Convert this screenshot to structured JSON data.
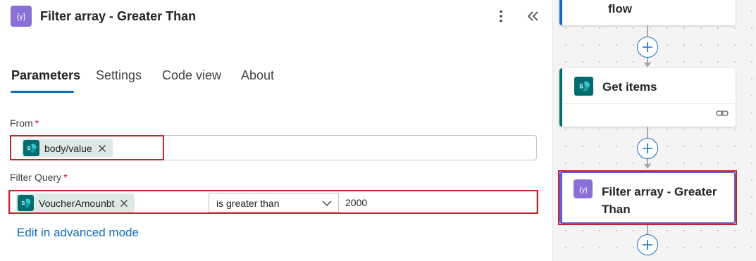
{
  "panel": {
    "title": "Filter array - Greater Than",
    "icon": "filter-array-icon",
    "more_icon": "more-vertical-icon",
    "collapse_icon": "double-chevron-left-icon",
    "tabs": [
      {
        "label": "Parameters",
        "active": true
      },
      {
        "label": "Settings",
        "active": false
      },
      {
        "label": "Code view",
        "active": false
      },
      {
        "label": "About",
        "active": false
      }
    ]
  },
  "from_field": {
    "label": "From",
    "required_mark": "*",
    "token": {
      "label": "body/value",
      "icon": "sharepoint-icon"
    }
  },
  "filter_query": {
    "label": "Filter Query",
    "required_mark": "*",
    "token": {
      "label": "VoucherAmounbt",
      "icon": "sharepoint-icon"
    },
    "operator": "is greater than",
    "value": "2000"
  },
  "advanced_mode_link": "Edit in advanced mode",
  "canvas": {
    "top_card_title": "flow",
    "get_items_card": {
      "title": "Get items",
      "icon": "sharepoint-icon",
      "link_icon": "link-icon"
    },
    "filter_card": {
      "title_line1": "Filter array - Greater",
      "title_line2": "Than",
      "icon": "filter-array-icon"
    }
  },
  "colors": {
    "accent": "#0f6cbd",
    "highlight_border": "#c0262d",
    "filter_icon_bg": "#8a6fd6",
    "sharepoint_bg": "#036c70",
    "token_bg": "#dde9e6",
    "selected_card_border": "#6a5fd6"
  }
}
